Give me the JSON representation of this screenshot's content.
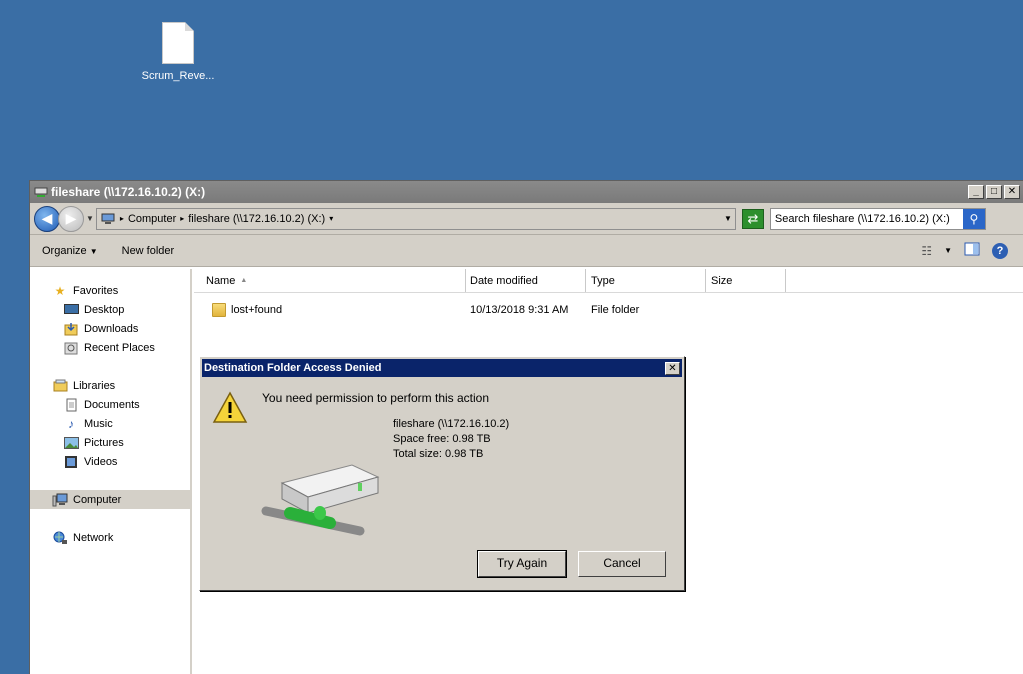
{
  "desktop": {
    "icon_label": "Scrum_Reve..."
  },
  "window": {
    "title": "fileshare (\\\\172.16.10.2) (X:)",
    "address": {
      "segments": [
        "Computer",
        "fileshare (\\\\172.16.10.2) (X:)"
      ]
    },
    "search_placeholder": "Search fileshare (\\\\172.16.10.2) (X:)",
    "toolbar": {
      "organize": "Organize",
      "new_folder": "New folder"
    },
    "nav": {
      "favorites": "Favorites",
      "desktop": "Desktop",
      "downloads": "Downloads",
      "recent": "Recent Places",
      "libraries": "Libraries",
      "documents": "Documents",
      "music": "Music",
      "pictures": "Pictures",
      "videos": "Videos",
      "computer": "Computer",
      "network": "Network"
    },
    "columns": {
      "name": "Name",
      "date": "Date modified",
      "type": "Type",
      "size": "Size"
    },
    "files": [
      {
        "name": "lost+found",
        "date": "10/13/2018 9:31 AM",
        "type": "File folder"
      }
    ]
  },
  "dialog": {
    "title": "Destination Folder Access Denied",
    "message": "You need permission to perform this action",
    "drive_name": "fileshare (\\\\172.16.10.2)",
    "space_free": "Space free: 0.98 TB",
    "total_size": "Total size: 0.98 TB",
    "try_again": "Try Again",
    "cancel": "Cancel"
  }
}
